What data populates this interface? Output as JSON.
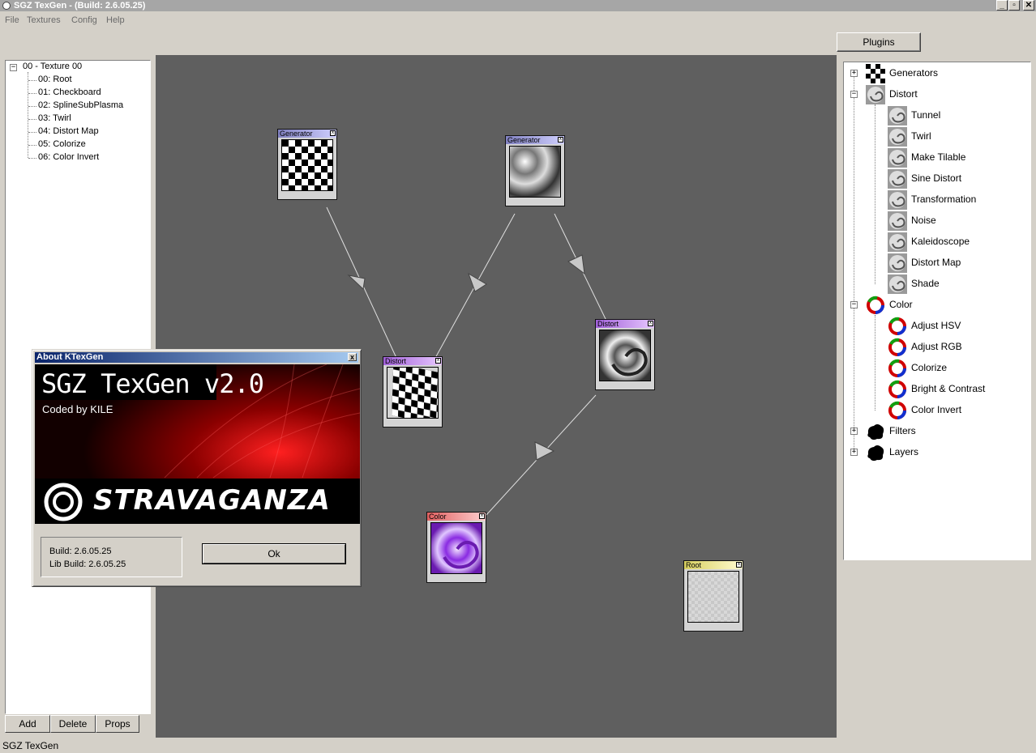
{
  "window": {
    "title": "SGZ TexGen - (Build: 2.6.05.25)",
    "min_glyph": "_",
    "max_glyph": "▫",
    "close_glyph": "✕"
  },
  "menu": [
    "File",
    "Textures",
    "Config",
    "Help"
  ],
  "texture_tree": {
    "root_label": "00 - Texture 00",
    "items": [
      "00: Root",
      "01: Checkboard",
      "02: SplineSubPlasma",
      "03: Twirl",
      "04: Distort Map",
      "05: Colorize",
      "06: Color Invert"
    ]
  },
  "tree_buttons": {
    "add": "Add",
    "delete": "Delete",
    "props": "Props"
  },
  "nodes": {
    "gen1": "Generator",
    "gen2": "Generator",
    "distort1": "Distort",
    "distort2": "Distort",
    "color": "Color",
    "root": "Root",
    "close_glyph": "x"
  },
  "about": {
    "title": "About KTexGen",
    "close_glyph": "x",
    "product": "SGZ TexGen v2.0",
    "coded_by": "Coded by KILE",
    "logo_text": "STRAVAGANZA",
    "build": "Build: 2.6.05.25",
    "lib_build": "Lib Build: 2.6.05.25",
    "ok": "Ok"
  },
  "plugins": {
    "tab": "Plugins",
    "generators": "Generators",
    "distort": "Distort",
    "distort_items": [
      "Tunnel",
      "Twirl",
      "Make Tilable",
      "Sine Distort",
      "Transformation",
      "Noise",
      "Kaleidoscope",
      "Distort Map",
      "Shade"
    ],
    "color": "Color",
    "color_items": [
      "Adjust HSV",
      "Adjust RGB",
      "Colorize",
      "Bright & Contrast",
      "Color Invert"
    ],
    "filters": "Filters",
    "layers": "Layers"
  },
  "status": "SGZ TexGen",
  "colors": {
    "canvas": "#5f5f5f",
    "gen_header": "#6a6ab4",
    "distort_header": "#b070e0",
    "color_header": "#e07070",
    "root_header": "#e8e070"
  }
}
